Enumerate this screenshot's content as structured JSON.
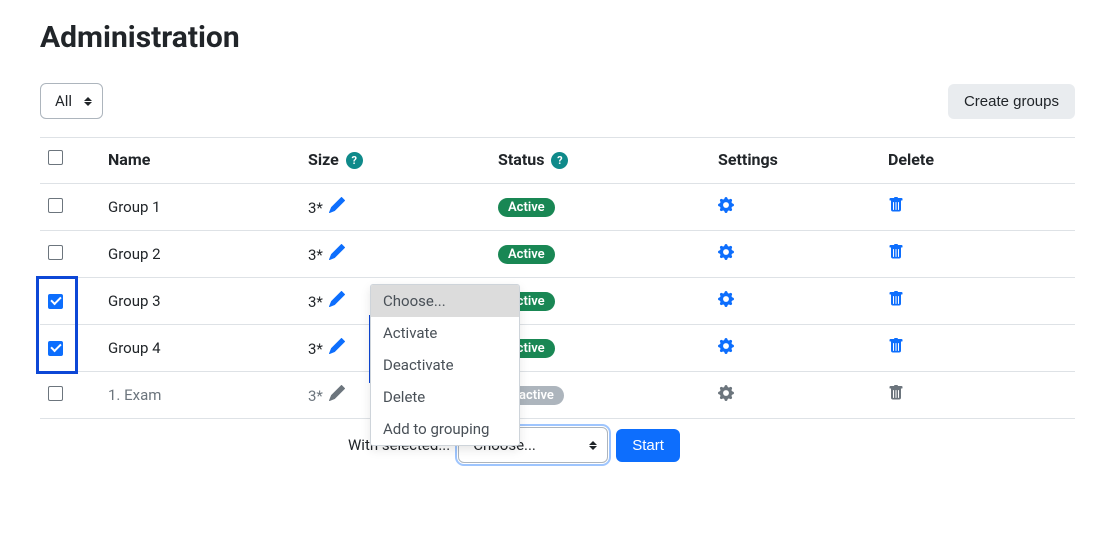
{
  "page_title": "Administration",
  "filter": {
    "selected": "All"
  },
  "buttons": {
    "create_groups": "Create groups",
    "start": "Start"
  },
  "table": {
    "headers": {
      "name": "Name",
      "size": "Size",
      "status": "Status",
      "settings": "Settings",
      "delete": "Delete"
    },
    "rows": [
      {
        "checked": false,
        "name": "Group 1",
        "size": "3*",
        "status": "Active",
        "status_color": "green",
        "muted": false
      },
      {
        "checked": false,
        "name": "Group 2",
        "size": "3*",
        "status": "Active",
        "status_color": "green",
        "muted": false
      },
      {
        "checked": true,
        "name": "Group 3",
        "size": "3*",
        "status": "Active",
        "status_color": "green",
        "muted": false
      },
      {
        "checked": true,
        "name": "Group 4",
        "size": "3*",
        "status": "Active",
        "status_color": "green",
        "muted": false
      },
      {
        "checked": false,
        "name": "1. Exam",
        "size": "3*",
        "status": "Inactive",
        "status_color": "gray",
        "muted": true
      }
    ]
  },
  "bulk": {
    "label": "With selected...",
    "selected": "Choose...",
    "options": [
      "Choose...",
      "Activate",
      "Deactivate",
      "Delete",
      "Add to grouping"
    ]
  },
  "help_glyph": "?"
}
